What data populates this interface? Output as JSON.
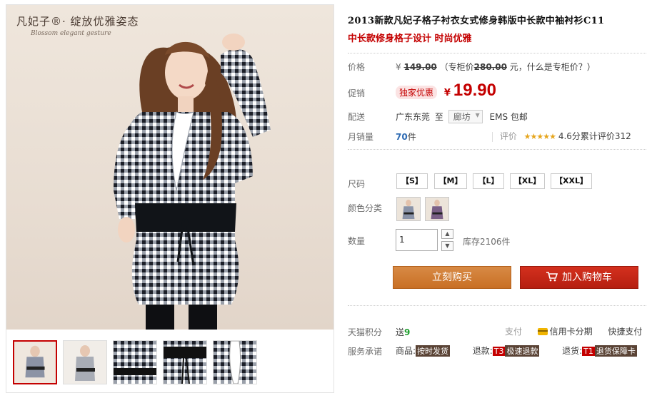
{
  "brand": {
    "name_cn": "凡妃子®· 绽放优雅姿态",
    "name_en": "Blossom elegant gesture"
  },
  "product": {
    "title": "2013新款凡妃子格子衬衣女式修身韩版中长款中袖衬衫C11",
    "subtitle": "中长款修身格子设计 时尚优雅"
  },
  "price_row": {
    "label": "价格",
    "currency": "¥",
    "original": "149.00",
    "counter_prefix": "（专柜价",
    "counter_price": "280.00",
    "counter_suffix": "元，",
    "counter_link": "什么是专柜价？",
    "counter_close": "）"
  },
  "promo_row": {
    "label": "促销",
    "badge": "独家优惠",
    "currency": "¥",
    "price": "19.90"
  },
  "shipping_row": {
    "label": "配送",
    "from": "广东东莞",
    "to_word": "至",
    "dest": "廊坊",
    "method": "EMS 包邮"
  },
  "sales_row": {
    "label": "月销量",
    "count": "70",
    "unit": "件",
    "review_label": "评价",
    "stars": "★★★★★",
    "rating_text": "4.6分累计评价312"
  },
  "size_row": {
    "label": "尺码",
    "options": [
      "【S】",
      "【M】",
      "【L】",
      "【XL】",
      "【XXL】"
    ]
  },
  "color_row": {
    "label": "颜色分类"
  },
  "qty_row": {
    "label": "数量",
    "value": "1",
    "up": "▲",
    "down": "▼",
    "stock": "库存2106件"
  },
  "actions": {
    "buy": "立刻购买",
    "cart": "加入购物车",
    "cart_icon": "cart-icon"
  },
  "service": {
    "points_label": "天猫积分",
    "points_prefix": "送",
    "points_value": "9",
    "pay_label": "支付",
    "credit_icon": "credit-card-icon",
    "credit_text": "信用卡分期",
    "quick_pay": "快捷支付",
    "promise_label": "服务承诺",
    "goods_label": "商品:",
    "goods_tag": "按时发货",
    "refund_label": "退款:",
    "refund_code": "T3",
    "refund_tag": "极速退款",
    "return_label": "退货:",
    "return_code": "T1",
    "return_tag": "退货保障卡"
  },
  "colors": {
    "accent_red": "#c40000",
    "buy_orange": "#c86f24",
    "cart_red": "#b51f10",
    "sales_blue": "#2e6bb3"
  }
}
